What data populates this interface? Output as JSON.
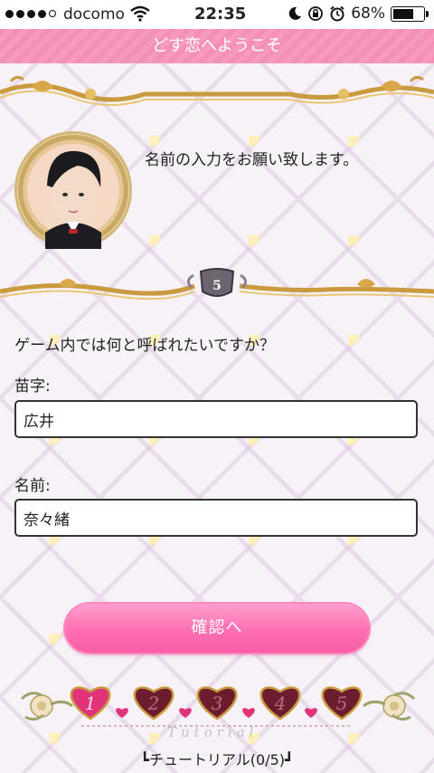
{
  "status_bar": {
    "carrier": "docomo",
    "time": "22:35",
    "battery_percent": "68%",
    "battery_level": 0.68,
    "icons": [
      "signal-dots-icon",
      "wifi-icon",
      "moon-icon",
      "rotation-lock-icon",
      "alarm-icon",
      "battery-icon"
    ]
  },
  "header": {
    "title": "どす恋へようこそ"
  },
  "intro": {
    "message": "名前の入力をお願い致します。"
  },
  "form": {
    "question": "ゲーム内では何と呼ばれたいですか？",
    "surname_label": "苗字:",
    "surname_value": "広井",
    "name_label": "名前:",
    "name_value": "奈々緒"
  },
  "confirm_button": {
    "label": "確認へ"
  },
  "tutorial": {
    "steps": [
      "1",
      "2",
      "3",
      "4",
      "5"
    ],
    "current_step": 1,
    "word": "Tutorial",
    "progress_label": "┗チュートリアル(0/5)┛"
  },
  "colors": {
    "accent_pink": "#f48fb9",
    "button_pink": "#ff6fb1",
    "heart_active": "#e0337a",
    "heart_inactive": "#6b1d2e",
    "gold": "#c99a3e"
  }
}
